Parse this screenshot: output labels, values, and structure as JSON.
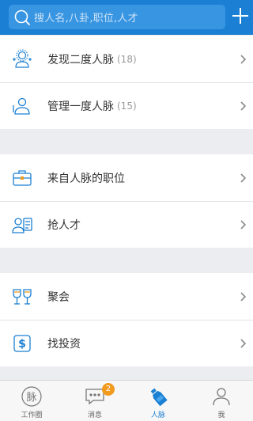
{
  "search": {
    "placeholder": "搜人名,八卦,职位,人才"
  },
  "groups": [
    {
      "items": [
        {
          "label": "发现二度人脉",
          "count": "(18)",
          "icon": "people-network-icon"
        },
        {
          "label": "管理一度人脉",
          "count": "(15)",
          "icon": "contacts-icon"
        }
      ]
    },
    {
      "items": [
        {
          "label": "来自人脉的职位",
          "icon": "briefcase-icon"
        },
        {
          "label": "抢人才",
          "icon": "talent-card-icon"
        }
      ]
    },
    {
      "items": [
        {
          "label": "聚会",
          "icon": "wine-glasses-icon"
        },
        {
          "label": "找投资",
          "icon": "dollar-icon"
        }
      ]
    }
  ],
  "tabs": [
    {
      "label": "工作圈",
      "icon_char": "脉",
      "icon": "work-circle-icon"
    },
    {
      "label": "消息",
      "badge": "2",
      "icon": "chat-bubble-icon"
    },
    {
      "label": "人脉",
      "icon": "bottle-icon",
      "active": true
    },
    {
      "label": "我",
      "icon": "user-icon"
    }
  ],
  "colors": {
    "header": "#1b7fd3",
    "accent": "#1b7fd3",
    "badge": "#f29a1e",
    "background": "#ecedf1"
  }
}
